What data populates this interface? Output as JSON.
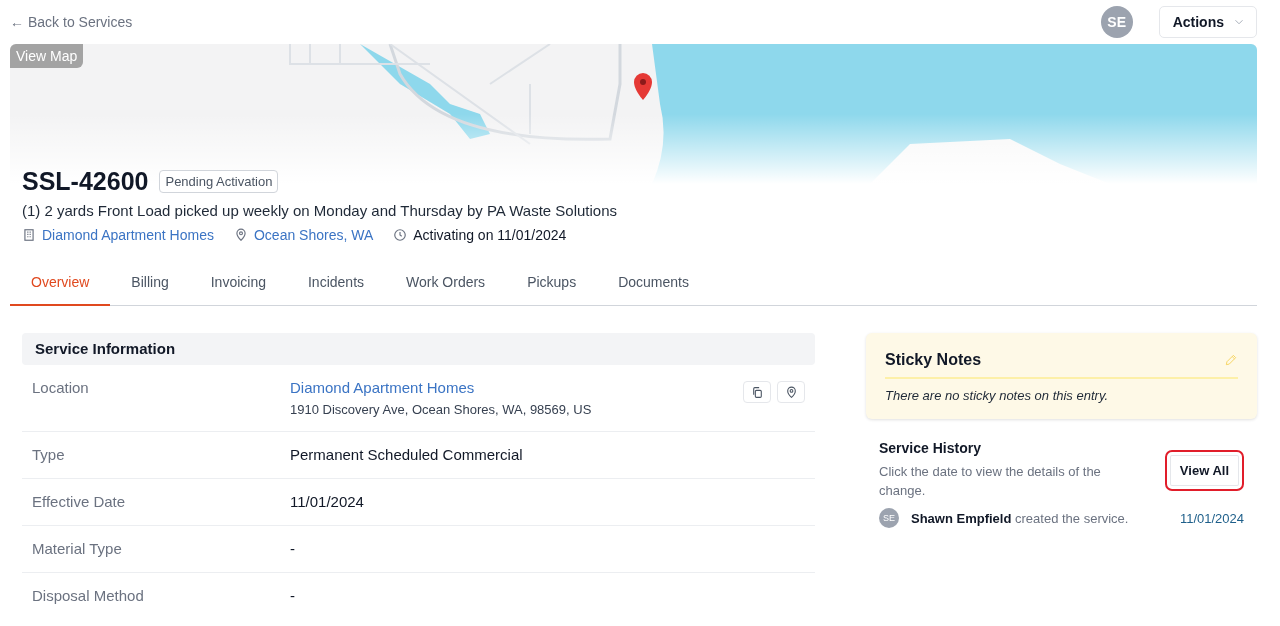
{
  "back_link": {
    "icon": "←",
    "label": "Back to Services"
  },
  "user_avatar": {
    "initials": "SE"
  },
  "actions_button": {
    "label": "Actions"
  },
  "map": {
    "button": "View Map"
  },
  "header": {
    "id": "SSL-42600",
    "status": "Pending Activation",
    "description": "(1) 2 yards Front Load picked up weekly on Monday and Thursday by PA Waste Solutions",
    "meta": [
      {
        "kind": "building",
        "text": "Diamond Apartment Homes",
        "link": true
      },
      {
        "kind": "pin",
        "text": "Ocean Shores, WA",
        "link": true
      },
      {
        "kind": "clock",
        "text": "Activating on 11/01/2024",
        "link": false
      }
    ]
  },
  "tabs": [
    {
      "label": "Overview",
      "selected": true
    },
    {
      "label": "Billing",
      "selected": false
    },
    {
      "label": "Invoicing",
      "selected": false
    },
    {
      "label": "Incidents",
      "selected": false
    },
    {
      "label": "Work Orders",
      "selected": false
    },
    {
      "label": "Pickups",
      "selected": false
    },
    {
      "label": "Documents",
      "selected": false
    }
  ],
  "service_information": {
    "title": "Service Information",
    "rows": [
      {
        "label": "Location",
        "value": "Diamond Apartment Homes",
        "link": true,
        "detail": "1910 Discovery Ave, Ocean Shores, WA, 98569, US",
        "actions": true
      },
      {
        "label": "Type",
        "value": "Permanent Scheduled Commercial",
        "link": false
      },
      {
        "label": "Effective Date",
        "value": "11/01/2024",
        "link": false
      },
      {
        "label": "Material Type",
        "value": "-",
        "link": false
      },
      {
        "label": "Disposal Method",
        "value": "-",
        "link": false
      }
    ]
  },
  "sticky_notes": {
    "title": "Sticky Notes",
    "empty_text": "There are no sticky notes on this entry."
  },
  "service_history": {
    "title": "Service History",
    "hint": "Click the date to view the details of the change.",
    "button": {
      "label": "View All",
      "highlighted": true
    },
    "entries": [
      {
        "initials": "SE",
        "text": "**Shawn Empfield** created the service.",
        "date": "11/01/2024"
      }
    ]
  }
}
